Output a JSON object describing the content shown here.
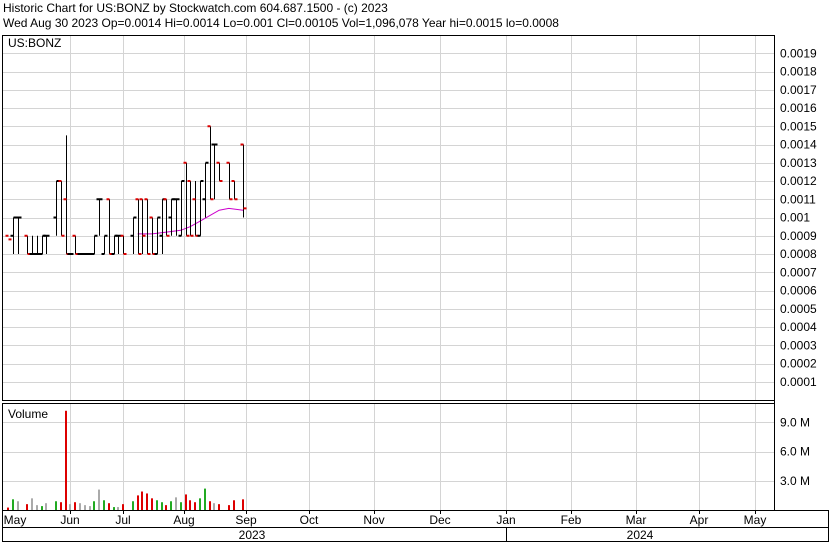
{
  "header": {
    "line1": "Historic Chart for US:BONZ by Stockwatch.com 604.687.1500 - (c) 2023",
    "line2": "Wed Aug 30 2023   Op=0.0014   Hi=0.0014   Lo=0.001   Cl=0.00105   Vol=1,096,078   Year hi=0.0015   lo=0.0008"
  },
  "colors": {
    "grid": "#d4d4d4",
    "up": "#000000",
    "down": "#dd0000",
    "moving_average": "#cc00cc",
    "volume_up": "#22aa22",
    "volume_down": "#dd0000",
    "volume_neutral": "#aaaaaa"
  },
  "chart_data": {
    "type": "ohlc",
    "price_panel": {
      "label": "US:BONZ",
      "ylim": [
        0,
        0.002
      ],
      "ytick_labels": [
        "0.0019",
        "0.0018",
        "0.0017",
        "0.0016",
        "0.0015",
        "0.0014",
        "0.0013",
        "0.0012",
        "0.0011",
        "0.001",
        "0.0009",
        "0.0008",
        "0.0007",
        "0.0006",
        "0.0005",
        "0.0004",
        "0.0003",
        "0.0002",
        "0.0001"
      ],
      "ytick_values": [
        0.0019,
        0.0018,
        0.0017,
        0.0016,
        0.0015,
        0.0014,
        0.0013,
        0.0012,
        0.0011,
        0.001,
        0.0009,
        0.0008,
        0.0007,
        0.0006,
        0.0005,
        0.0004,
        0.0003,
        0.0002,
        0.0001
      ]
    },
    "volume_panel": {
      "label": "Volume",
      "ylim": [
        0,
        11000000
      ],
      "ytick_labels": [
        "9.0 M",
        "6.0 M",
        "3.0 M"
      ],
      "ytick_values": [
        9000000,
        6000000,
        3000000
      ]
    },
    "x_axis": {
      "months": [
        "May",
        "Jun",
        "Jul",
        "Aug",
        "Sep",
        "Oct",
        "Nov",
        "Dec",
        "Jan",
        "Feb",
        "Mar",
        "Apr",
        "May"
      ],
      "years": [
        "2023",
        "2024"
      ]
    },
    "series": [
      {
        "x": 0,
        "o": 0.0009,
        "h": 0.0009,
        "l": 0.0009,
        "c": 0.00088,
        "v": 250000
      },
      {
        "x": 1,
        "o": 0.0009,
        "h": 0.001,
        "l": 0.0008,
        "c": 0.001,
        "v": 1100000
      },
      {
        "x": 2,
        "o": 0.001,
        "h": 0.001,
        "l": 0.0008,
        "c": 0.001,
        "v": 900000
      },
      {
        "x": 4,
        "o": 0.0009,
        "h": 0.0009,
        "l": 0.0008,
        "c": 0.0008,
        "v": 600000
      },
      {
        "x": 5,
        "o": 0.0008,
        "h": 0.0009,
        "l": 0.0008,
        "c": 0.0008,
        "v": 1200000
      },
      {
        "x": 6,
        "o": 0.0008,
        "h": 0.0009,
        "l": 0.0008,
        "c": 0.0008,
        "v": 500000
      },
      {
        "x": 7,
        "o": 0.0008,
        "h": 0.0009,
        "l": 0.0008,
        "c": 0.0009,
        "v": 400000
      },
      {
        "x": 8,
        "o": 0.0009,
        "h": 0.0009,
        "l": 0.0008,
        "c": 0.0009,
        "v": 700000
      },
      {
        "x": 10,
        "o": 0.001,
        "h": 0.0012,
        "l": 0.0009,
        "c": 0.0012,
        "v": 900000
      },
      {
        "x": 11,
        "o": 0.0012,
        "h": 0.0012,
        "l": 0.0009,
        "c": 0.0009,
        "v": 800000
      },
      {
        "x": 12,
        "o": 0.0011,
        "h": 0.00145,
        "l": 0.0008,
        "c": 0.0008,
        "v": 10200000
      },
      {
        "x": 13,
        "o": 0.0008,
        "h": 0.0008,
        "l": 0.0008,
        "c": 0.0008,
        "v": 600000
      },
      {
        "x": 14,
        "o": 0.0009,
        "h": 0.0009,
        "l": 0.0008,
        "c": 0.0008,
        "v": 800000
      },
      {
        "x": 15,
        "o": 0.0008,
        "h": 0.0008,
        "l": 0.0008,
        "c": 0.0008,
        "v": 700000
      },
      {
        "x": 16,
        "o": 0.0008,
        "h": 0.0008,
        "l": 0.0008,
        "c": 0.0008,
        "v": 500000
      },
      {
        "x": 17,
        "o": 0.0008,
        "h": 0.0008,
        "l": 0.0008,
        "c": 0.0008,
        "v": 400000
      },
      {
        "x": 18,
        "o": 0.0008,
        "h": 0.0009,
        "l": 0.0008,
        "c": 0.0009,
        "v": 900000
      },
      {
        "x": 19,
        "o": 0.0011,
        "h": 0.0011,
        "l": 0.0009,
        "c": 0.0011,
        "v": 2100000
      },
      {
        "x": 20,
        "o": 0.0008,
        "h": 0.0009,
        "l": 0.0008,
        "c": 0.0009,
        "v": 1000000
      },
      {
        "x": 21,
        "o": 0.0011,
        "h": 0.0011,
        "l": 0.0008,
        "c": 0.0008,
        "v": 700000
      },
      {
        "x": 22,
        "o": 0.0008,
        "h": 0.0009,
        "l": 0.0008,
        "c": 0.0009,
        "v": 300000
      },
      {
        "x": 23,
        "o": 0.0009,
        "h": 0.0009,
        "l": 0.0008,
        "c": 0.0009,
        "v": 300000
      },
      {
        "x": 24,
        "o": 0.0009,
        "h": 0.0009,
        "l": 0.0008,
        "c": 0.0008,
        "v": 600000
      },
      {
        "x": 26,
        "o": 0.0009,
        "h": 0.001,
        "l": 0.0008,
        "c": 0.001,
        "v": 900000
      },
      {
        "x": 27,
        "o": 0.0011,
        "h": 0.0011,
        "l": 0.0008,
        "c": 0.0008,
        "v": 1500000
      },
      {
        "x": 28,
        "o": 0.0011,
        "h": 0.0011,
        "l": 0.0008,
        "c": 0.0009,
        "v": 1900000
      },
      {
        "x": 29,
        "o": 0.0011,
        "h": 0.0011,
        "l": 0.0008,
        "c": 0.0008,
        "v": 1700000
      },
      {
        "x": 30,
        "o": 0.001,
        "h": 0.001,
        "l": 0.0008,
        "c": 0.0008,
        "v": 1200000
      },
      {
        "x": 31,
        "o": 0.0008,
        "h": 0.001,
        "l": 0.0008,
        "c": 0.001,
        "v": 1000000
      },
      {
        "x": 32,
        "o": 0.0009,
        "h": 0.0011,
        "l": 0.0008,
        "c": 0.0011,
        "v": 800000
      },
      {
        "x": 33,
        "o": 0.0011,
        "h": 0.0011,
        "l": 0.0009,
        "c": 0.0009,
        "v": 500000
      },
      {
        "x": 34,
        "o": 0.001,
        "h": 0.0011,
        "l": 0.0009,
        "c": 0.0011,
        "v": 900000
      },
      {
        "x": 35,
        "o": 0.0011,
        "h": 0.0011,
        "l": 0.0009,
        "c": 0.0011,
        "v": 1300000
      },
      {
        "x": 36,
        "o": 0.0009,
        "h": 0.0012,
        "l": 0.0009,
        "c": 0.0012,
        "v": 800000
      },
      {
        "x": 37,
        "o": 0.0013,
        "h": 0.0013,
        "l": 0.0009,
        "c": 0.0009,
        "v": 1600000
      },
      {
        "x": 38,
        "o": 0.0012,
        "h": 0.0012,
        "l": 0.0009,
        "c": 0.0009,
        "v": 1000000
      },
      {
        "x": 39,
        "o": 0.0011,
        "h": 0.0012,
        "l": 0.0009,
        "c": 0.0009,
        "v": 800000
      },
      {
        "x": 40,
        "o": 0.0009,
        "h": 0.0012,
        "l": 0.0009,
        "c": 0.0012,
        "v": 1200000
      },
      {
        "x": 41,
        "o": 0.0011,
        "h": 0.0013,
        "l": 0.001,
        "c": 0.0013,
        "v": 2200000
      },
      {
        "x": 42,
        "o": 0.0015,
        "h": 0.0015,
        "l": 0.0011,
        "c": 0.0011,
        "v": 900000
      },
      {
        "x": 43,
        "o": 0.0014,
        "h": 0.0014,
        "l": 0.0011,
        "c": 0.0014,
        "v": 700000
      },
      {
        "x": 44,
        "o": 0.0013,
        "h": 0.0013,
        "l": 0.0012,
        "c": 0.0012,
        "v": 600000
      },
      {
        "x": 46,
        "o": 0.0013,
        "h": 0.0013,
        "l": 0.0011,
        "c": 0.0011,
        "v": 500000
      },
      {
        "x": 47,
        "o": 0.0012,
        "h": 0.0012,
        "l": 0.0011,
        "c": 0.0011,
        "v": 1000000
      },
      {
        "x": 49,
        "o": 0.0014,
        "h": 0.0014,
        "l": 0.001,
        "c": 0.00105,
        "v": 1096078
      }
    ],
    "moving_average": [
      {
        "x": 27,
        "y": 0.00091
      },
      {
        "x": 30,
        "y": 0.00091
      },
      {
        "x": 33,
        "y": 0.00092
      },
      {
        "x": 36,
        "y": 0.00093
      },
      {
        "x": 38,
        "y": 0.00095
      },
      {
        "x": 40,
        "y": 0.00098
      },
      {
        "x": 42,
        "y": 0.00101
      },
      {
        "x": 44,
        "y": 0.00104
      },
      {
        "x": 46,
        "y": 0.00105
      },
      {
        "x": 49,
        "y": 0.00104
      }
    ]
  }
}
